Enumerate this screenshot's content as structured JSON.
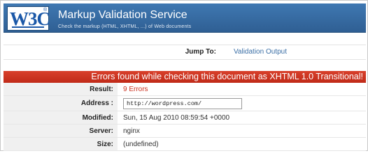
{
  "header": {
    "logo_text_w3": "W3",
    "logo_text_c": "C",
    "logo_mark": "®",
    "title": "Markup Validation Service",
    "subtitle": "Check the markup (HTML, XHTML, ...) of Web documents"
  },
  "jump": {
    "label": "Jump To:",
    "link": "Validation Output"
  },
  "error_banner": {
    "text": "Errors found while checking this document as XHTML 1.0 Transitional!"
  },
  "results": {
    "result_label": "Result:",
    "result_value": "9 Errors",
    "address_label": "Address :",
    "address_value": "http://wordpress.com/",
    "modified_label": "Modified:",
    "modified_value": "Sun, 15 Aug 2010 08:59:54 +0000",
    "server_label": "Server:",
    "server_value": "nginx",
    "size_label": "Size:",
    "size_value": "(undefined)"
  },
  "colors": {
    "banner_blue": "#3a6ea5",
    "error_red": "#cc3322",
    "link_blue": "#3a6ea5"
  }
}
